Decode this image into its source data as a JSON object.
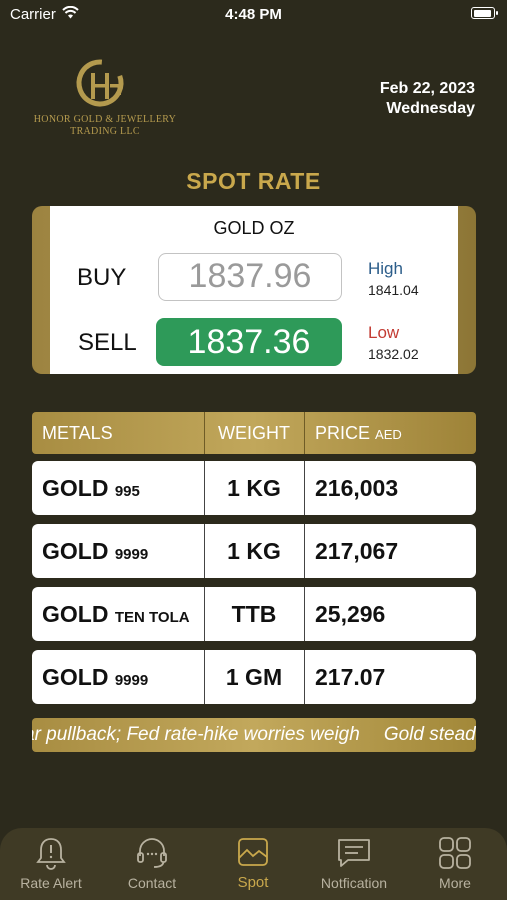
{
  "status_bar": {
    "carrier": "Carrier",
    "time": "4:48 PM"
  },
  "logo": {
    "line1": "HONOR GOLD & JEWELLERY",
    "line2": "TRADING LLC"
  },
  "date": {
    "day": "Feb 22, 2023",
    "weekday": "Wednesday"
  },
  "spot": {
    "title": "SPOT RATE",
    "metal": "GOLD OZ",
    "buy_label": "BUY",
    "sell_label": "SELL",
    "buy_value": "1837.96",
    "sell_value": "1837.36",
    "high_label": "High",
    "high_value": "1841.04",
    "low_label": "Low",
    "low_value": "1832.02"
  },
  "table": {
    "headers": {
      "metals": "METALS",
      "weight": "WEIGHT",
      "price": "PRICE",
      "price_unit": "AED"
    },
    "rows": [
      {
        "metal": "GOLD",
        "sub": "995",
        "weight": "1 KG",
        "price": "216,003"
      },
      {
        "metal": "GOLD",
        "sub": "9999",
        "weight": "1 KG",
        "price": "217,067"
      },
      {
        "metal": "GOLD",
        "sub": "TEN TOLA",
        "weight": "TTB",
        "price": "25,296"
      },
      {
        "metal": "GOLD",
        "sub": "9999",
        "weight": "1 GM",
        "price": "217.07"
      }
    ]
  },
  "ticker": {
    "item1": "ar pullback; Fed rate-hike worries weigh",
    "item2": "Gold stead"
  },
  "tabs": [
    {
      "label": "Rate Alert",
      "icon": "alert-icon",
      "active": false
    },
    {
      "label": "Contact",
      "icon": "headset-icon",
      "active": false
    },
    {
      "label": "Spot",
      "icon": "chart-icon",
      "active": true
    },
    {
      "label": "Notfication",
      "icon": "message-icon",
      "active": false
    },
    {
      "label": "More",
      "icon": "grid-icon",
      "active": false
    }
  ],
  "colors": {
    "background": "#2c2a1c",
    "gold": "#c9a84c",
    "sell_green": "#2e9a59",
    "high_blue": "#2c5d8a",
    "low_red": "#c33b33"
  }
}
